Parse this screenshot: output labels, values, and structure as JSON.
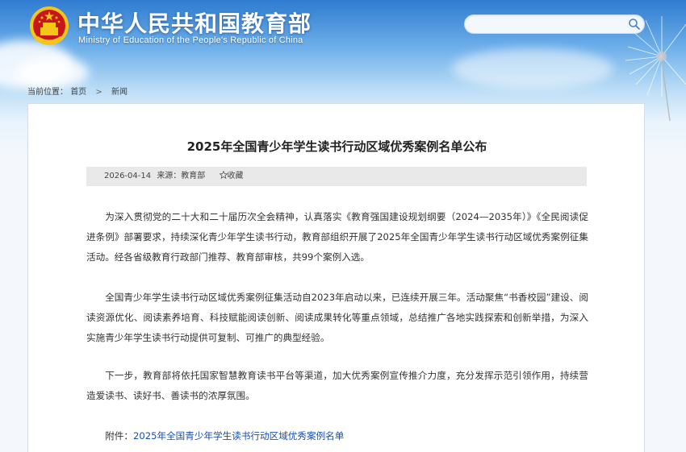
{
  "header": {
    "title": "中华人民共和国教育部",
    "subtitle": "Ministry of Education of the People's Republic of China",
    "search_placeholder": ""
  },
  "icons": {
    "emblem": "national-emblem-icon",
    "search": "search-icon",
    "favorite": "star-icon"
  },
  "colors": {
    "header_blue": "#2f7bd0",
    "link_blue": "#1a4fb5",
    "emblem_red": "#c8161d",
    "emblem_gold": "#f5c518"
  },
  "breadcrumb": {
    "label": "当前位置：",
    "items": [
      "首页",
      "新闻"
    ],
    "separator": ">"
  },
  "article": {
    "title": "2025年全国青少年学生读书行动区域优秀案例名单公布",
    "date": "2026-04-14",
    "source": "来源：教育部",
    "favorite_label": "收藏",
    "paragraphs": [
      "为深入贯彻党的二十大和二十届历次全会精神，认真落实《教育强国建设规划纲要（2024—2035年）》《全民阅读促进条例》部署要求，持续深化青少年学生读书行动，教育部组织开展了2025年全国青少年学生读书行动区域优秀案例征集活动。经各省级教育行政部门推荐、教育部审核，共99个案例入选。",
      "全国青少年学生读书行动区域优秀案例征集活动自2023年启动以来，已连续开展三年。活动聚焦“书香校园”建设、阅读资源优化、阅读素养培育、科技赋能阅读创新、阅读成果转化等重点领域，总结推广各地实践探索和创新举措，为深入实施青少年学生读书行动提供可复制、可推广的典型经验。",
      "下一步，教育部将依托国家智慧教育读书平台等渠道，加大优秀案例宣传推介力度，充分发挥示范引领作用，持续营造爱读书、读好书、善读书的浓厚氛围。"
    ],
    "attachment_label": "附件：",
    "attachment_link": "2025年全国青少年学生读书行动区域优秀案例名单"
  }
}
